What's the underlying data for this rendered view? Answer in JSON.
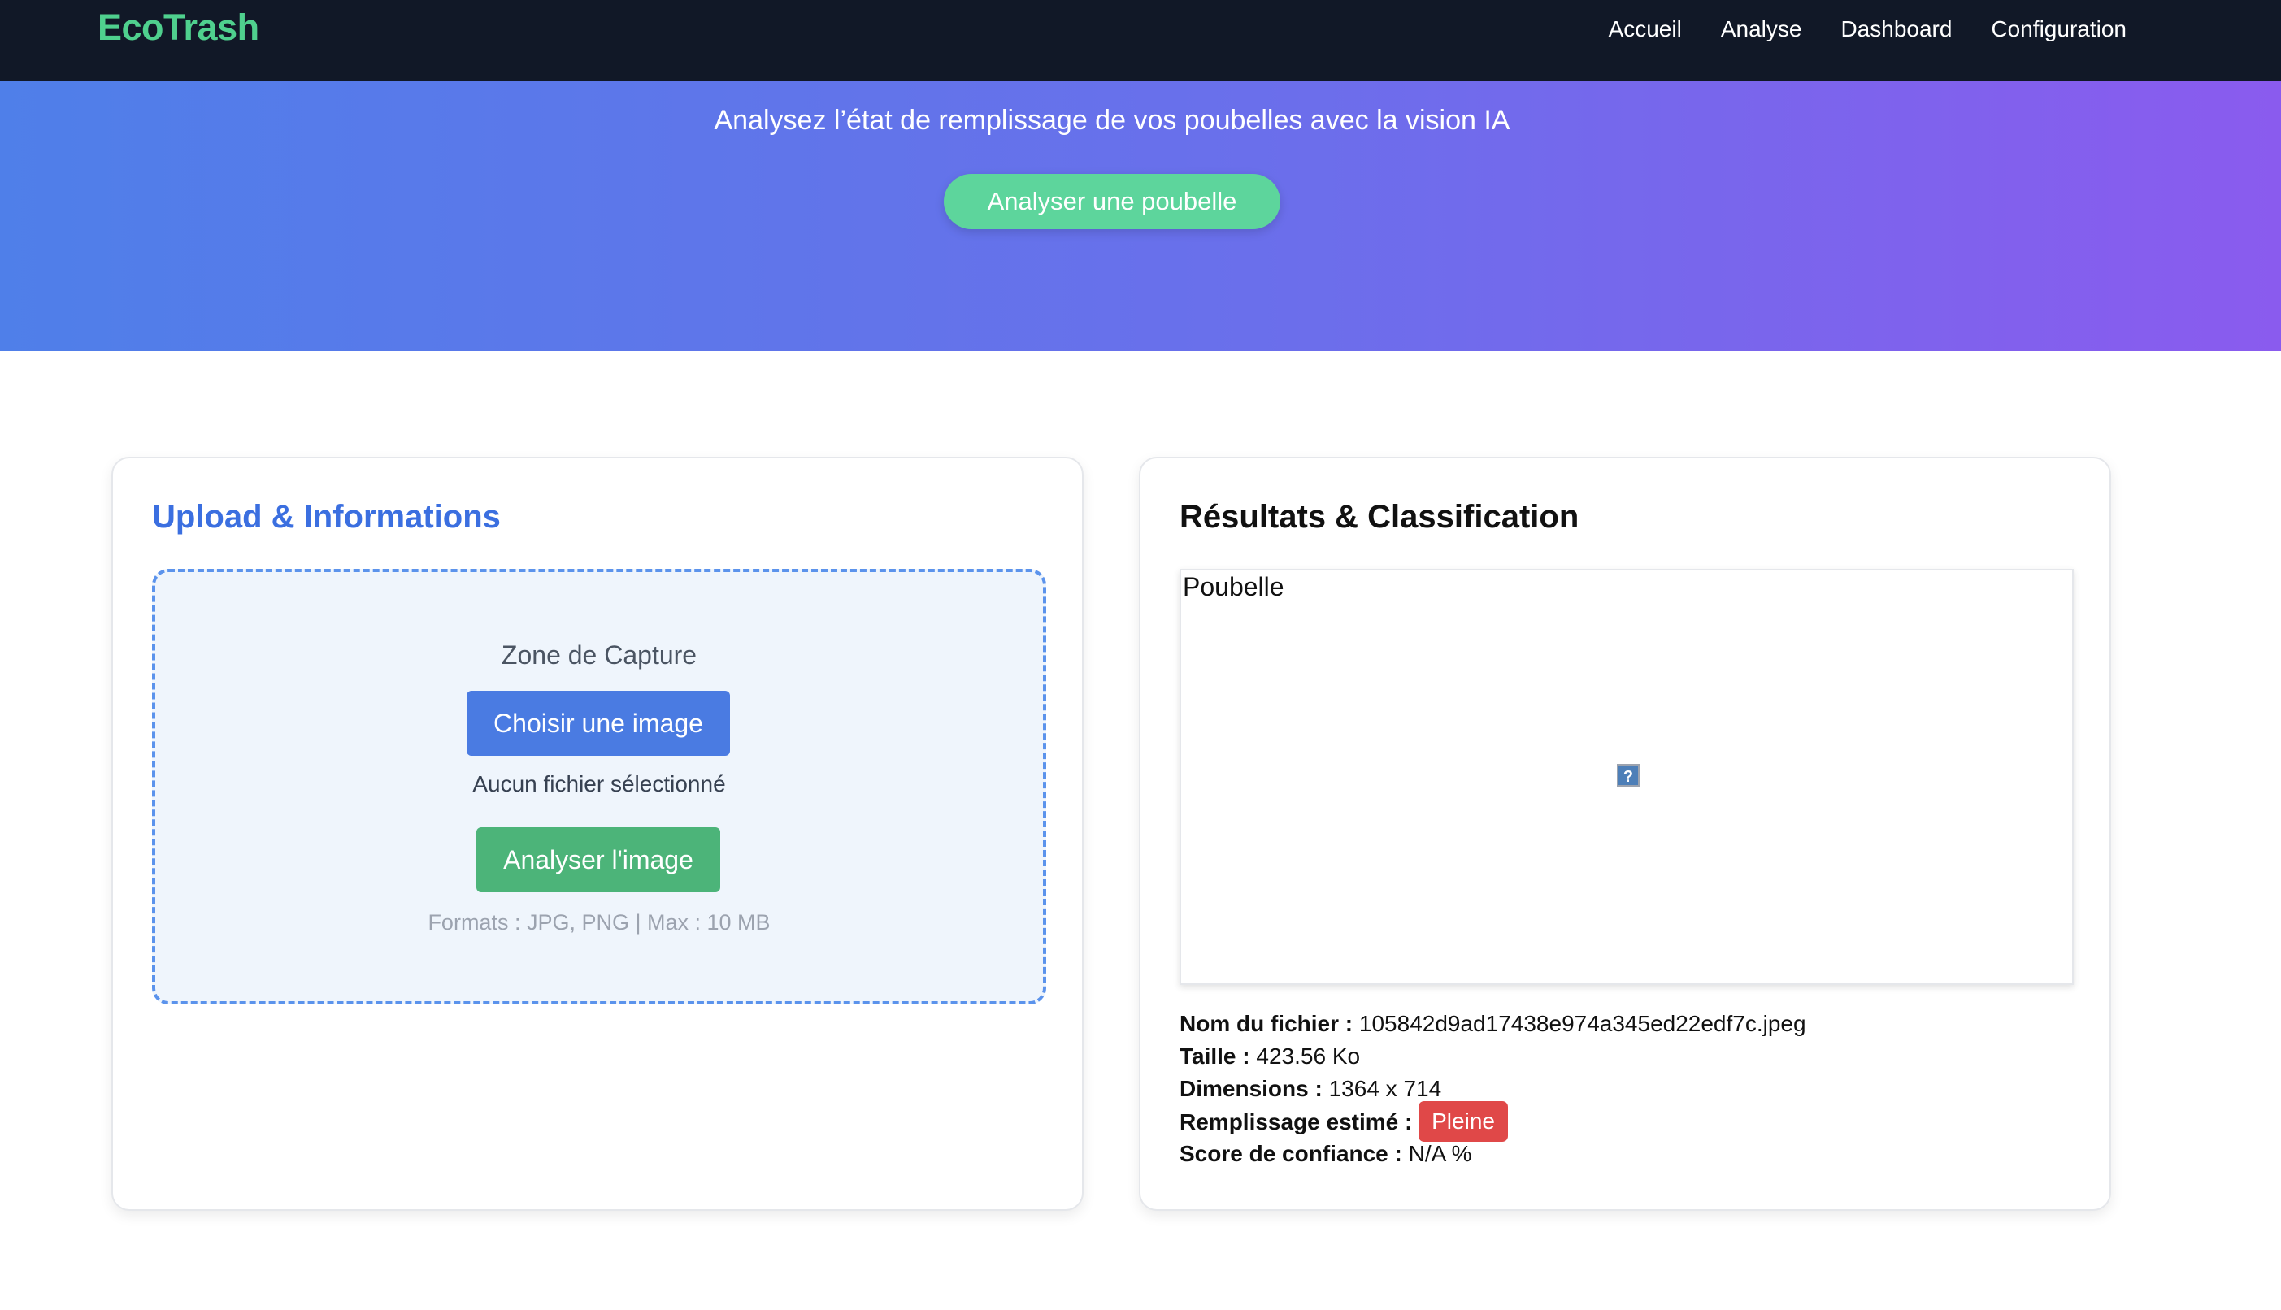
{
  "navbar": {
    "brand": "EcoTrash",
    "links": [
      "Accueil",
      "Analyse",
      "Dashboard",
      "Configuration"
    ]
  },
  "hero": {
    "subtitle": "Analysez l’état de remplissage de vos poubelles avec la vision IA",
    "cta": "Analyser une poubelle"
  },
  "upload_card": {
    "title": "Upload & Informations",
    "zone_label": "Zone de Capture",
    "choose_button": "Choisir une image",
    "no_file": "Aucun fichier sélectionné",
    "analyze_button": "Analyser l'image",
    "formats": "Formats : JPG, PNG | Max : 10 MB"
  },
  "results_card": {
    "title": "Résultats & Classification",
    "image_alt": "Poubelle",
    "info": {
      "filename_label": "Nom du fichier :",
      "filename": "105842d9ad17438e974a345ed22edf7c.jpeg",
      "size_label": "Taille :",
      "size": "423.56 Ko",
      "dimensions_label": "Dimensions :",
      "dimensions": "1364 x 714",
      "fill_label": "Remplissage estimé :",
      "fill": "Pleine",
      "confidence_label": "Score de confiance :",
      "confidence": "N/A %"
    }
  },
  "colors": {
    "navbar_bg": "#111827",
    "brand": "#4fd08e",
    "hero_start": "#4f7fe9",
    "hero_end": "#8a5bee",
    "cta": "#5dd59c",
    "upload_title": "#3b6fe0",
    "choose_button": "#4a7be2",
    "analyze_button": "#4cb479",
    "fill_badge": "#e04848"
  },
  "icons": {
    "broken_image": "broken-image-icon"
  }
}
